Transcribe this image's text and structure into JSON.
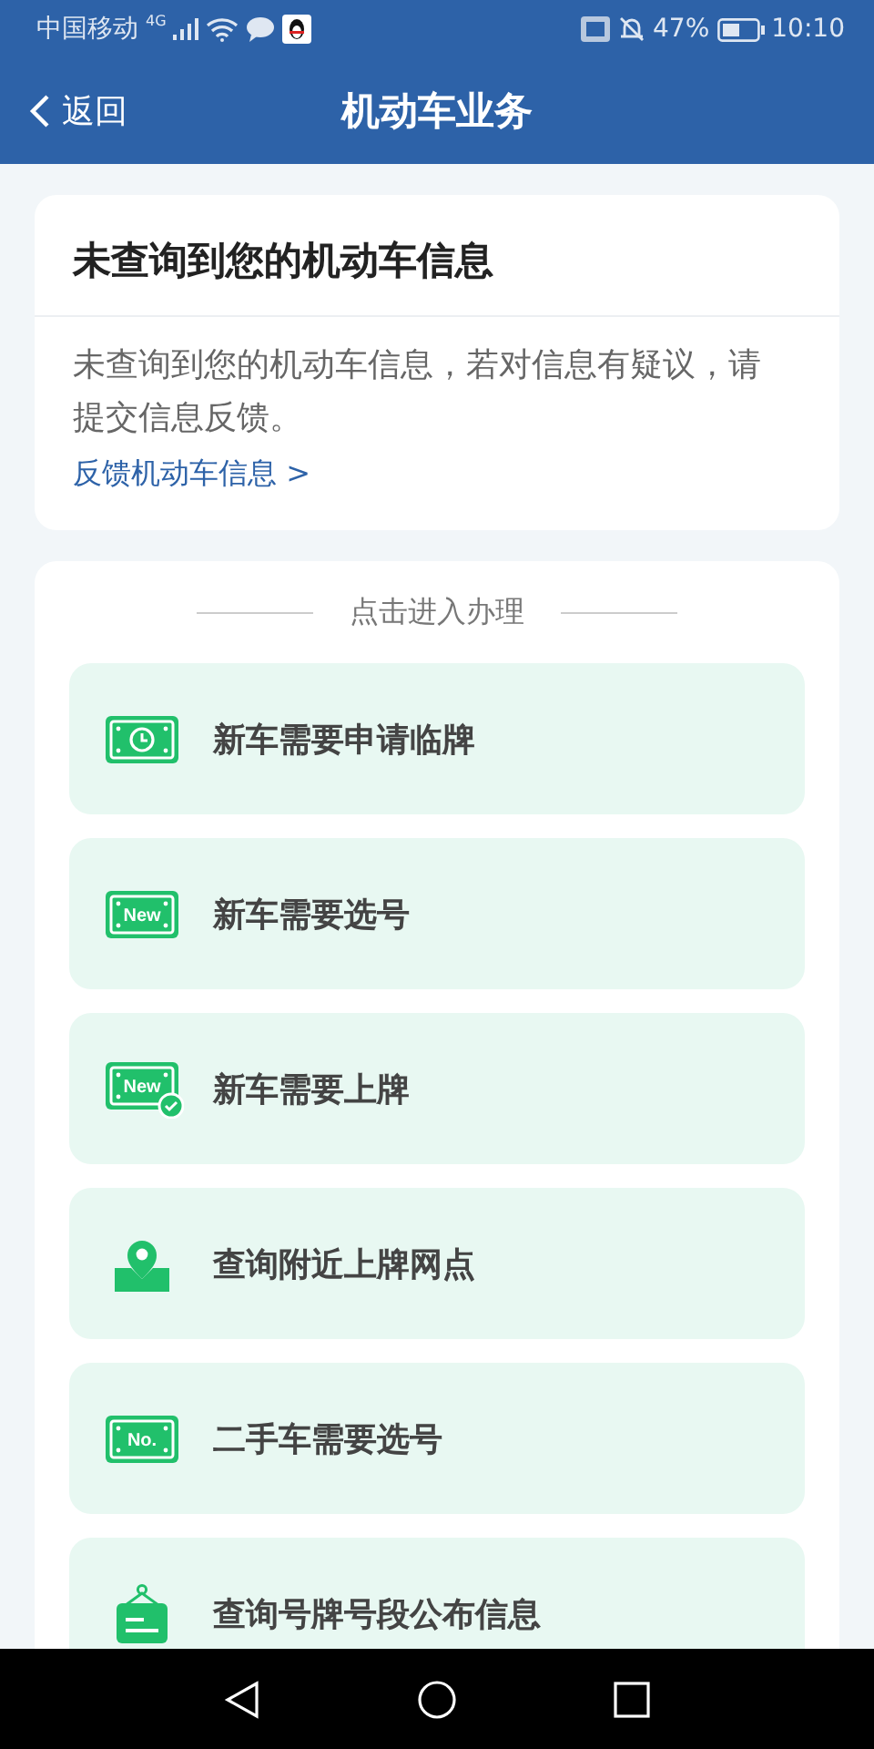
{
  "status_bar": {
    "carrier": "中国移动",
    "network": "4G",
    "battery": "47%",
    "time": "10:10"
  },
  "header": {
    "back": "返回",
    "title": "机动车业务"
  },
  "notice": {
    "title": "未查询到您的机动车信息",
    "message": "未查询到您的机动车信息，若对信息有疑议，请提交信息反馈。",
    "link": "反馈机动车信息 >"
  },
  "services": {
    "heading": "点击进入办理",
    "items": [
      {
        "kind": "clock-plate",
        "label": "新车需要申请临牌"
      },
      {
        "kind": "text-plate",
        "icon_text": "New",
        "label": "新车需要选号"
      },
      {
        "kind": "checked-plate",
        "icon_text": "New",
        "label": "新车需要上牌"
      },
      {
        "kind": "pin",
        "label": "查询附近上牌网点"
      },
      {
        "kind": "text-plate",
        "icon_text": "No.",
        "label": "二手车需要选号"
      },
      {
        "kind": "sign",
        "label": "查询号牌号段公布信息"
      }
    ]
  }
}
